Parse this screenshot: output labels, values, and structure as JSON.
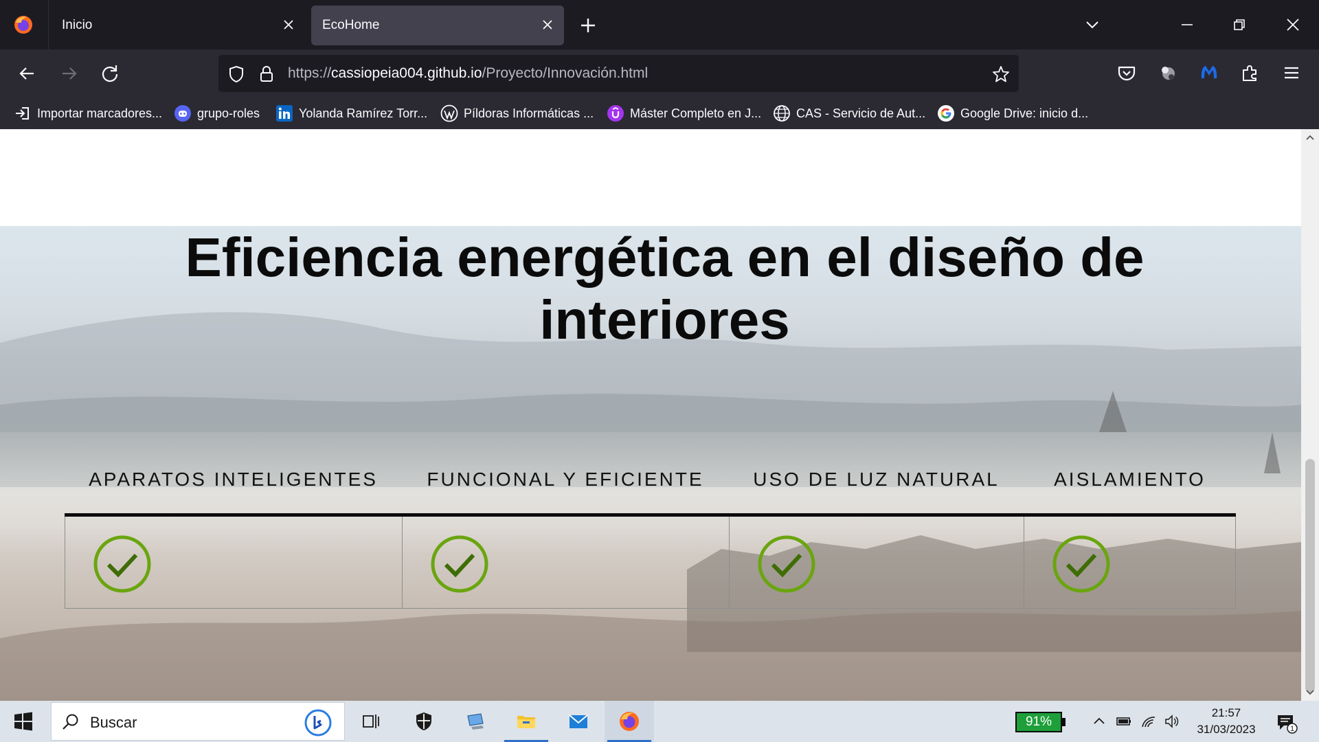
{
  "browser": {
    "tabs": [
      {
        "label": "Inicio",
        "active": false
      },
      {
        "label": "EcoHome",
        "active": true
      }
    ],
    "url": {
      "scheme": "https://",
      "host": "cassiopeia004.github.io",
      "path": "/Proyecto/Innovación.html"
    },
    "bookmarks": [
      {
        "label": "Importar marcadores...",
        "icon": "import-icon"
      },
      {
        "label": "grupo-roles",
        "icon": "discord-icon"
      },
      {
        "label": "Yolanda Ramírez Torr...",
        "icon": "linkedin-icon"
      },
      {
        "label": "Píldoras Informáticas ...",
        "icon": "wordpress-icon"
      },
      {
        "label": "Máster Completo en J...",
        "icon": "udemy-icon"
      },
      {
        "label": "CAS - Servicio de Aut...",
        "icon": "globe-icon"
      },
      {
        "label": "Google Drive: inicio d...",
        "icon": "google-icon"
      }
    ]
  },
  "page": {
    "title": "Eficiencia energética en el diseño de interiores",
    "features": [
      {
        "label": "APARATOS INTELIGENTES",
        "icon": "check-circle-icon"
      },
      {
        "label": "FUNCIONAL Y EFICIENTE",
        "icon": "check-circle-icon"
      },
      {
        "label": "USO DE LUZ NATURAL",
        "icon": "check-circle-icon"
      },
      {
        "label": "AISLAMIENTO",
        "icon": "check-circle-icon"
      }
    ],
    "accent_color": "#6aa50f"
  },
  "taskbar": {
    "search_placeholder": "Buscar",
    "battery": "91%",
    "time": "21:57",
    "date": "31/03/2023",
    "notification_count": "1"
  }
}
